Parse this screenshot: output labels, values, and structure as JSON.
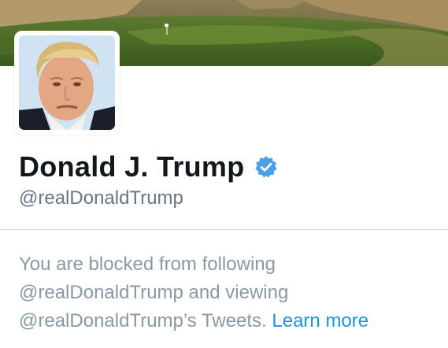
{
  "profile": {
    "display_name": "Donald J. Trump",
    "handle": "@realDonaldTrump",
    "verified": true,
    "verified_icon": "verified-badge-icon",
    "verified_color": "#4a9fe6"
  },
  "blocked_notice": {
    "line1": "You are blocked from following",
    "line2": "@realDonaldTrump and viewing",
    "line3": "@realDonaldTrump’s Tweets.",
    "link_label": "Learn more",
    "link_color": "#1b95e0",
    "text_color": "#8899a6"
  }
}
